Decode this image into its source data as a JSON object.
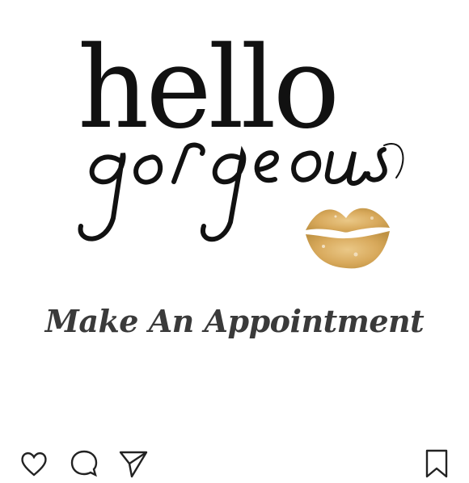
{
  "post": {
    "headline": "hello",
    "script_text": "gorgeous",
    "cta": "Make An Appointment"
  },
  "actions": {
    "like_icon": "heart-outline-icon",
    "comment_icon": "speech-bubble-icon",
    "share_icon": "paper-plane-icon",
    "save_icon": "bookmark-icon"
  },
  "colors": {
    "text_dark": "#111111",
    "cta": "#3a3a3a",
    "lips_gold": "#d4a04a",
    "background": "#ffffff"
  }
}
